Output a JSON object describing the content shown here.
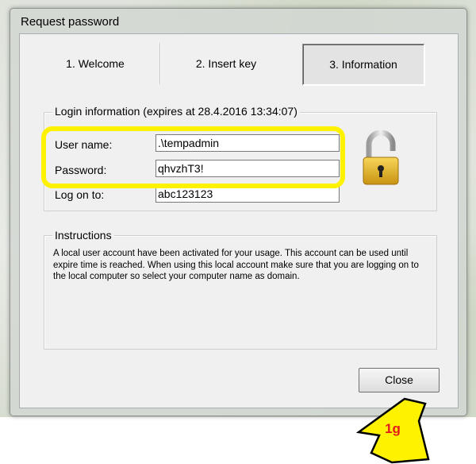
{
  "window": {
    "title": "Request password"
  },
  "steps": [
    {
      "label": "1. Welcome"
    },
    {
      "label": "2. Insert key"
    },
    {
      "label": "3. Information"
    }
  ],
  "login": {
    "legend": "Login information (expires at 28.4.2016 13:34:07)",
    "user_label": "User name:",
    "user_value": ".\\tempadmin",
    "password_label": "Password:",
    "password_value": "qhvzhT3!",
    "logon_label": "Log on to:",
    "logon_value": "abc123123"
  },
  "instructions": {
    "legend": "Instructions",
    "text": "A local user account have been activated for your usage. This account can be used until expire time is reached. When using this local account make sure that you are logging on to the local computer so select your computer name as domain."
  },
  "close_label": "Close",
  "annotation": {
    "label": "1g"
  },
  "colors": {
    "highlight": "#fff200",
    "annotation_text": "#e31b1b",
    "lock_gold": "#e8b824"
  }
}
